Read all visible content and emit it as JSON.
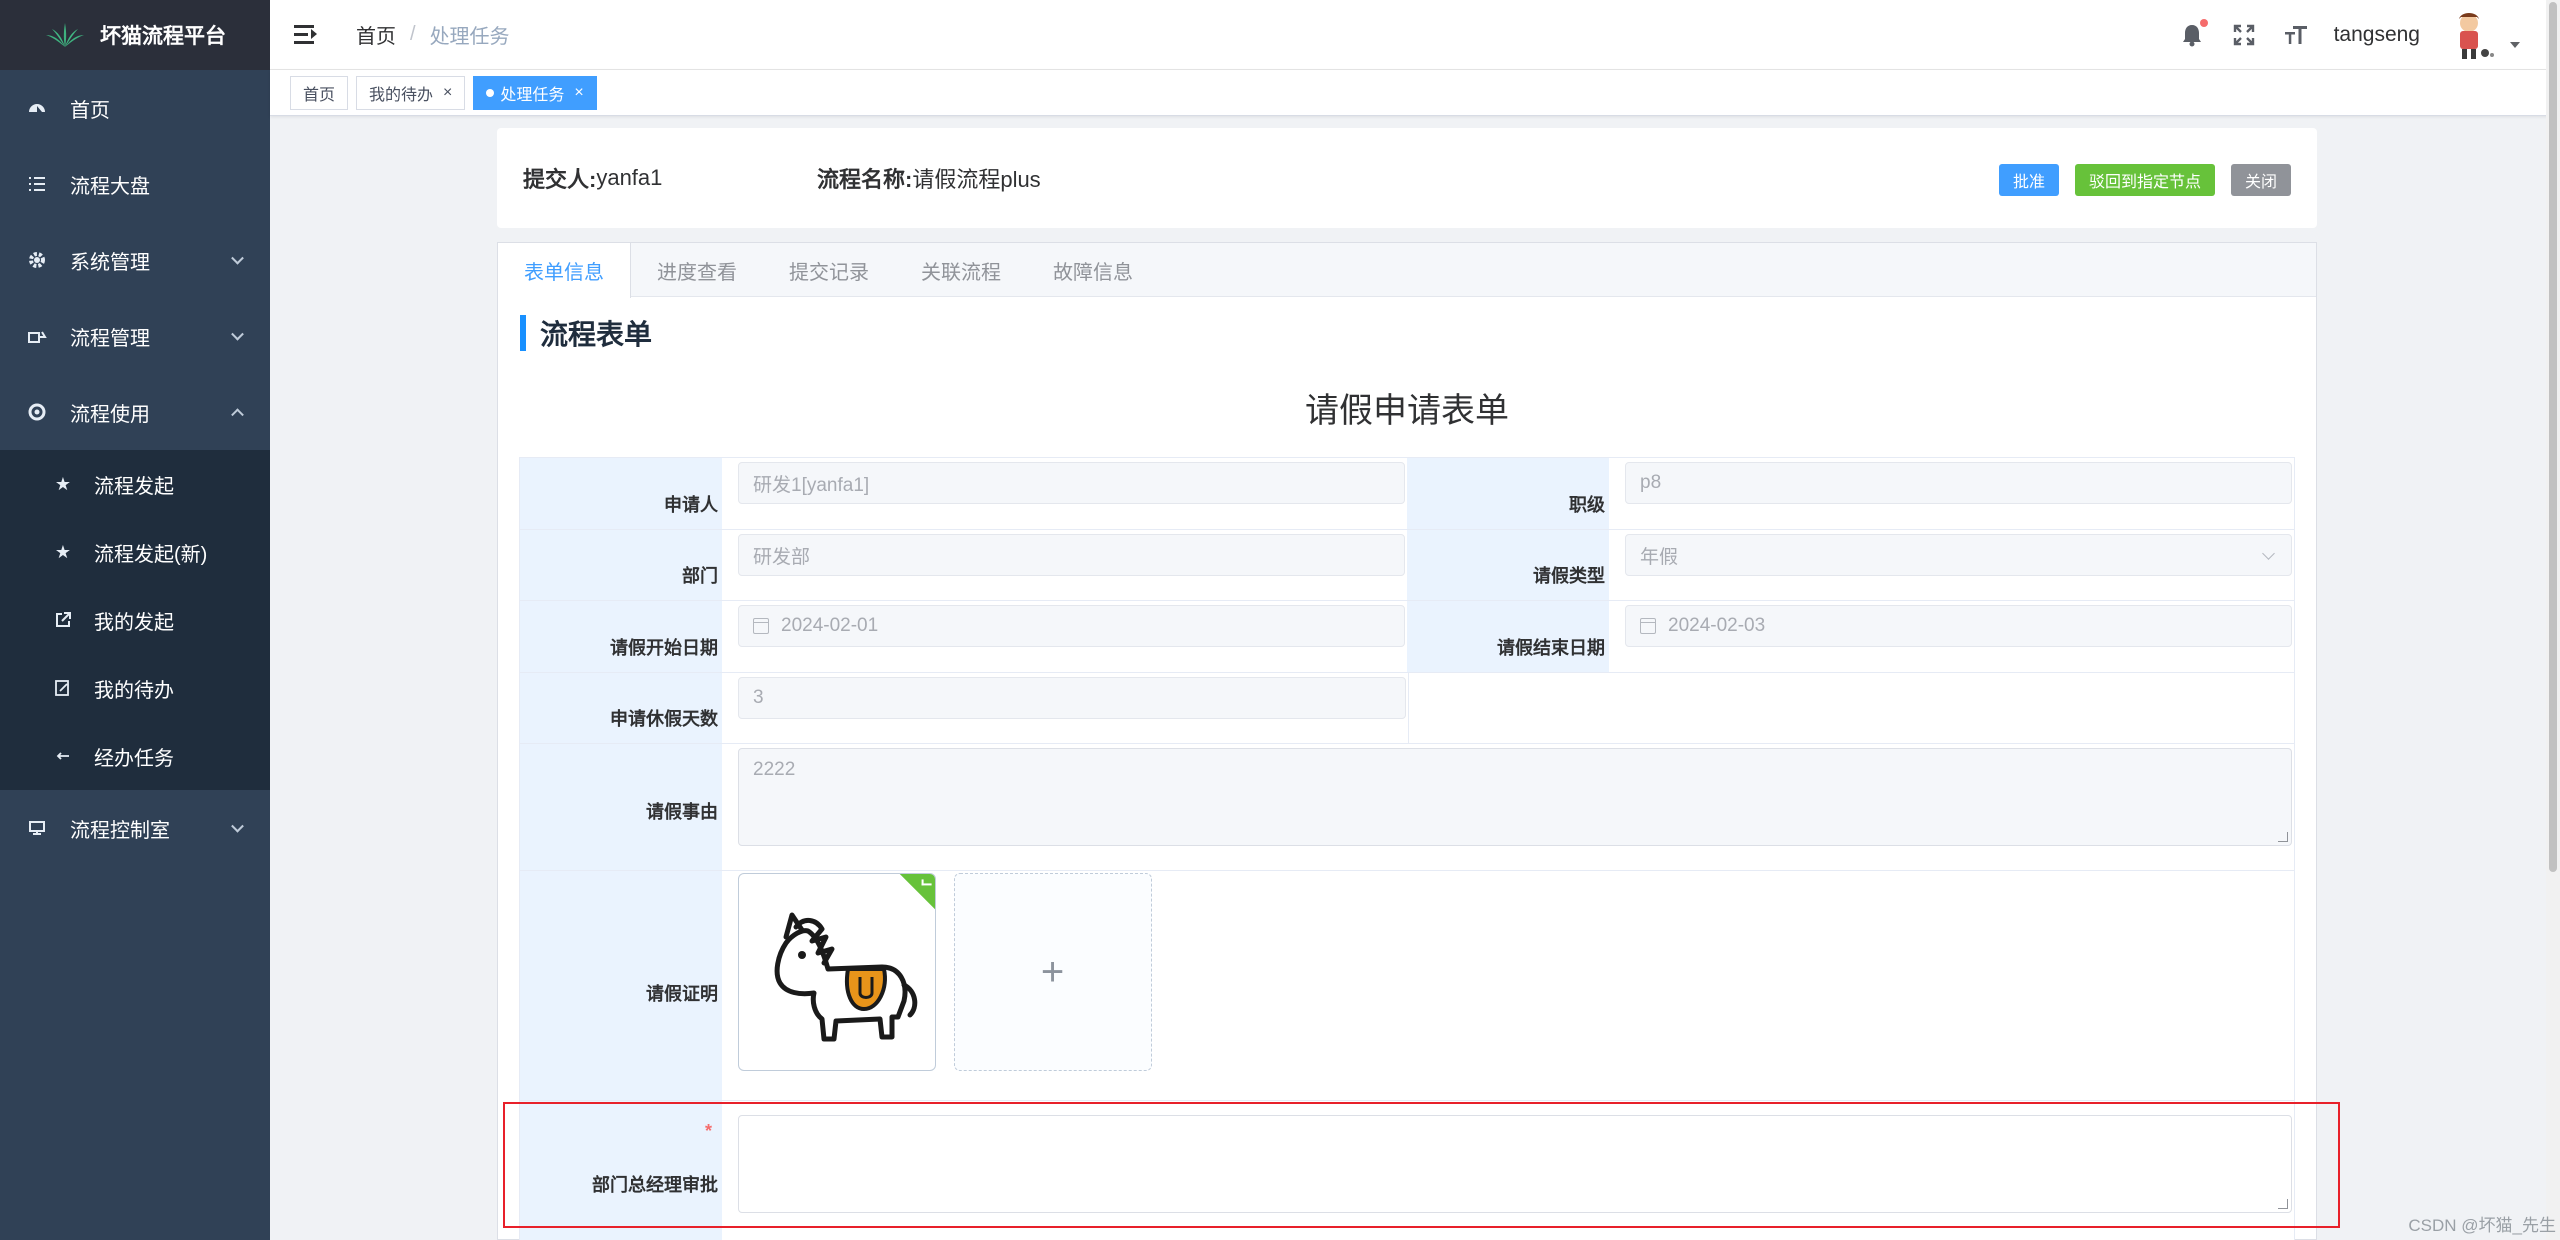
{
  "app": {
    "title": "坏猫流程平台"
  },
  "sidebar": {
    "items": [
      {
        "label": "首页",
        "icon": "dashboard-icon"
      },
      {
        "label": "流程大盘",
        "icon": "list-icon"
      },
      {
        "label": "系统管理",
        "icon": "gear-icon",
        "expandable": true
      },
      {
        "label": "流程管理",
        "icon": "flow-icon",
        "expandable": true
      },
      {
        "label": "流程使用",
        "icon": "cycle-icon",
        "expandable": true,
        "expanded": true
      },
      {
        "label": "流程控制室",
        "icon": "monitor-icon",
        "expandable": true
      }
    ],
    "sub_items": [
      {
        "label": "流程发起",
        "icon": "star-icon"
      },
      {
        "label": "流程发起(新)",
        "icon": "star-icon"
      },
      {
        "label": "我的发起",
        "icon": "external-link-icon"
      },
      {
        "label": "我的待办",
        "icon": "edit-icon"
      },
      {
        "label": "经办任务",
        "icon": "arrow-left-icon"
      }
    ]
  },
  "navbar": {
    "breadcrumb": [
      "首页",
      "处理任务"
    ],
    "separator": "/",
    "username": "tangseng"
  },
  "tags": [
    {
      "label": "首页",
      "active": false
    },
    {
      "label": "我的待办",
      "active": false,
      "closable": true
    },
    {
      "label": "处理任务",
      "active": true,
      "closable": true
    }
  ],
  "header": {
    "submitter_label": "提交人:",
    "submitter": "yanfa1",
    "flow_name_label": "流程名称:",
    "flow_name": "请假流程plus",
    "buttons": {
      "approve": "批准",
      "reject_to_node": "驳回到指定节点",
      "close": "关闭"
    }
  },
  "tabs": [
    "表单信息",
    "进度查看",
    "提交记录",
    "关联流程",
    "故障信息"
  ],
  "form": {
    "section_title": "流程表单",
    "title": "请假申请表单",
    "fields": {
      "applicant": {
        "label": "申请人",
        "value": "研发1[yanfa1]"
      },
      "level": {
        "label": "职级",
        "value": "p8"
      },
      "department": {
        "label": "部门",
        "value": "研发部"
      },
      "leave_type": {
        "label": "请假类型",
        "value": "年假"
      },
      "start_date": {
        "label": "请假开始日期",
        "value": "2024-02-01"
      },
      "end_date": {
        "label": "请假结束日期",
        "value": "2024-02-03"
      },
      "days": {
        "label": "申请休假天数",
        "value": "3"
      },
      "reason": {
        "label": "请假事由",
        "value": "2222"
      },
      "proof": {
        "label": "请假证明",
        "upload_plus": "+"
      },
      "manager_approval": {
        "label": "部门总经理审批",
        "required_mark": "*",
        "value": ""
      }
    }
  },
  "watermark": "CSDN @坏猫_先生",
  "colors": {
    "primary": "#409eff",
    "success": "#67c23a",
    "info": "#909399",
    "sidebar": "#304156",
    "highlight": "#e8202a"
  }
}
